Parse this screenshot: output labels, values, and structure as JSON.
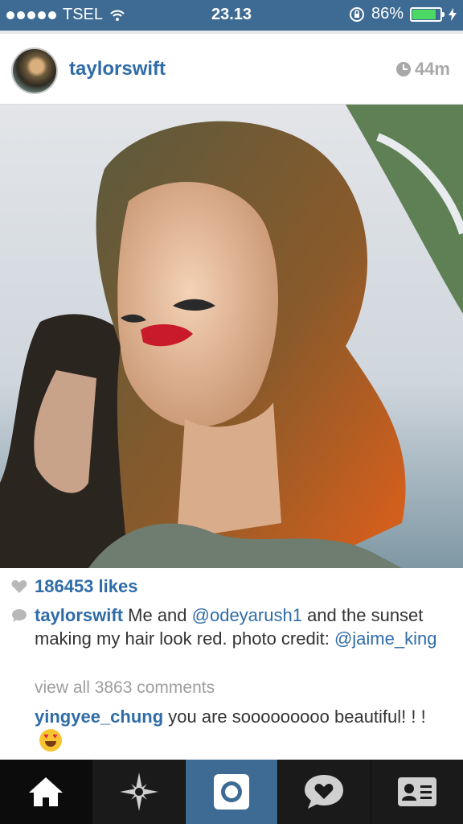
{
  "status_bar": {
    "carrier": "TSEL",
    "time": "23.13",
    "battery_percent": "86%",
    "battery_level": 0.86
  },
  "post": {
    "username": "taylorswift",
    "time_ago": "44m",
    "likes": "186453 likes",
    "caption": {
      "username": "taylorswift",
      "part1": " Me and ",
      "mention1": "@odeyarush1",
      "part2": " and the sunset making my hair look red. photo credit: ",
      "mention2": "@jaime_king"
    },
    "view_all_comments": "view all 3863 comments",
    "comments": [
      {
        "username": "yingyee_chung",
        "text": " you are sooooooooo beautiful! ! ! "
      }
    ]
  },
  "tab_bar": {
    "tabs": [
      {
        "name": "home",
        "icon": "home-icon"
      },
      {
        "name": "explore",
        "icon": "explore-star-icon"
      },
      {
        "name": "camera",
        "icon": "camera-icon"
      },
      {
        "name": "activity",
        "icon": "heart-bubble-icon"
      },
      {
        "name": "profile",
        "icon": "profile-card-icon"
      }
    ]
  },
  "colors": {
    "status_bar": "#3e6b93",
    "link": "#2f6ca8",
    "tab_bar": "#1a1a1a",
    "battery": "#4cd964"
  }
}
